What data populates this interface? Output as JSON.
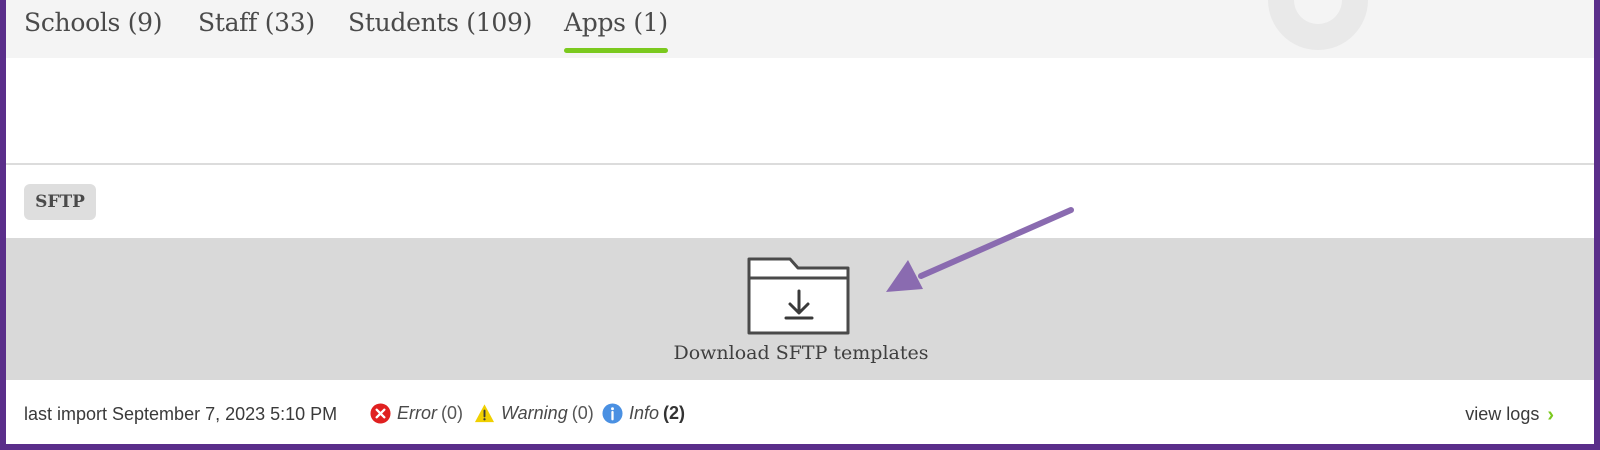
{
  "tabs": [
    {
      "label": "Schools (9)"
    },
    {
      "label": "Staff (33)"
    },
    {
      "label": "Students (109)"
    },
    {
      "label": "Apps (1)",
      "active": true
    }
  ],
  "badge": {
    "label": "SFTP"
  },
  "download": {
    "label": "Download SFTP templates",
    "icon": "folder-download-icon"
  },
  "footer": {
    "last_import": "last import September 7, 2023 5:10 PM",
    "statuses": [
      {
        "icon": "error-icon",
        "name": "Error",
        "count": "(0)"
      },
      {
        "icon": "warning-icon",
        "name": "Warning",
        "count": "(0)"
      },
      {
        "icon": "info-icon",
        "name": "Info",
        "count": "(2)"
      }
    ],
    "view_logs": "view logs"
  },
  "colors": {
    "frame": "#5a2e8a",
    "accent": "#7bc91e",
    "annotation_arrow": "#8a6bb0",
    "error": "#e02020",
    "warning": "#f0d000",
    "info": "#4a90e2"
  }
}
